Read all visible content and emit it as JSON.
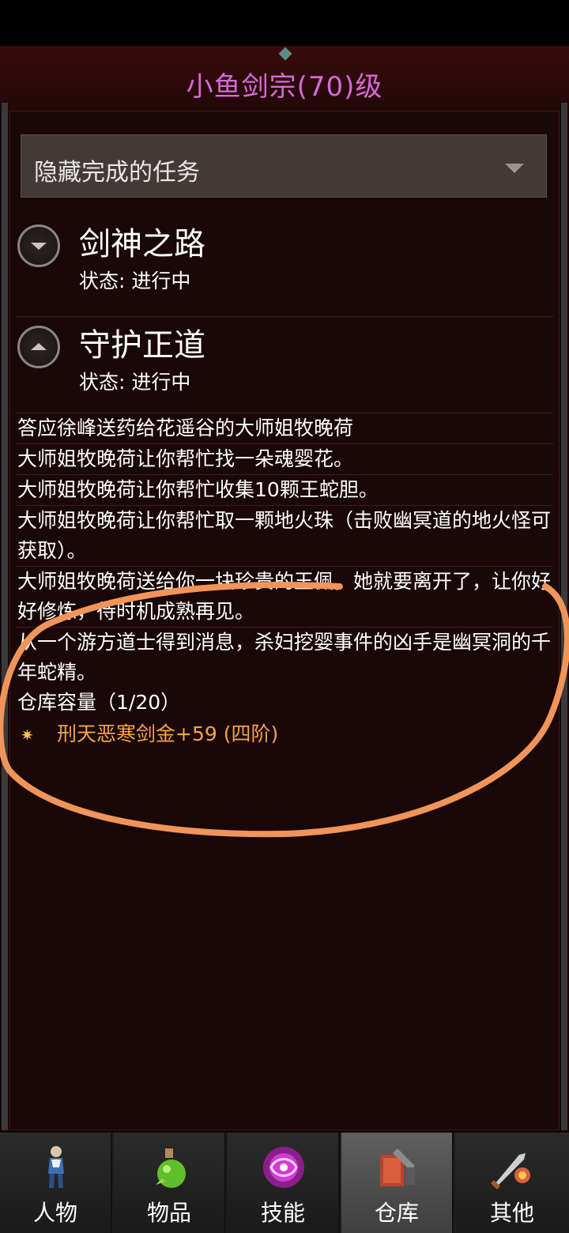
{
  "window": {
    "title": "小鱼剑宗(70)级"
  },
  "filter": {
    "label": "隐藏完成的任务"
  },
  "quests": [
    {
      "title": "剑神之路",
      "status": "状态: 进行中",
      "expanded": false
    },
    {
      "title": "守护正道",
      "status": "状态: 进行中",
      "expanded": true
    }
  ],
  "quest_details": [
    "答应徐峰送药给花遥谷的大师姐牧晚荷",
    "大师姐牧晚荷让你帮忙找一朵魂婴花。",
    "大师姐牧晚荷让你帮忙收集10颗王蛇胆。",
    "大师姐牧晚荷让你帮忙取一颗地火珠（击败幽冥道的地火怪可获取）。",
    "大师姐牧晚荷送给你一块珍贵的玉佩，她就要离开了，让你好好修炼，待时机成熟再见。",
    "从一个游方道士得到消息，杀妇挖婴事件的凶手是幽冥洞的千年蛇精。"
  ],
  "warehouse": {
    "capacity_label": "仓库容量（1/20）",
    "items": [
      {
        "name": "刑天恶寒剑金+59 (四阶)",
        "icon": "star-icon"
      }
    ]
  },
  "tabs": [
    {
      "label": "人物",
      "icon": "character-icon"
    },
    {
      "label": "物品",
      "icon": "potion-icon"
    },
    {
      "label": "技能",
      "icon": "skill-orb-icon"
    },
    {
      "label": "仓库",
      "icon": "warehouse-icon",
      "active": true
    },
    {
      "label": "其他",
      "icon": "sword-icon"
    }
  ],
  "colors": {
    "title": "#d66ad8",
    "item_name": "#f2a44a",
    "background": "#1a0707",
    "annotation_circle": "#f0945a"
  }
}
